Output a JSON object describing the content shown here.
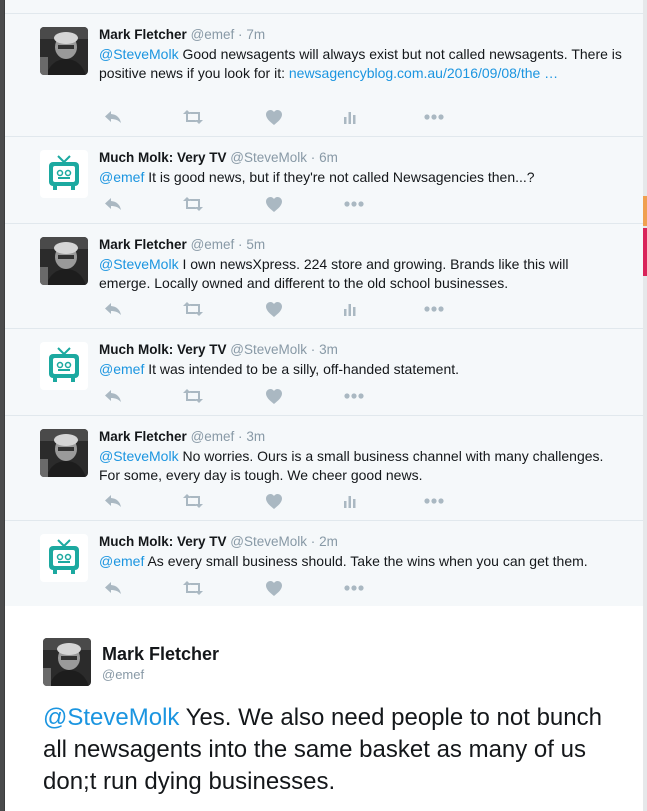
{
  "tweets": [
    {
      "author": "Mark Fletcher",
      "handle": "@emef",
      "sep": "·",
      "time": "7m",
      "mention": "@SteveMolk",
      "text": " Good newsagents will always exist but not called newsagents. There is positive news if you look for it: ",
      "link": "newsagencyblog.com.au/2016/09/08/the …",
      "avatar": "mark-fletcher-avatar",
      "analytics": true
    },
    {
      "author": "Much Molk: Very TV",
      "handle": "@SteveMolk",
      "sep": "·",
      "time": "6m",
      "mention": "@emef",
      "text": " It is good news, but if they're not called Newsagencies then...?",
      "link": "",
      "avatar": "much-molk-avatar",
      "analytics": false
    },
    {
      "author": "Mark Fletcher",
      "handle": "@emef",
      "sep": "·",
      "time": "5m",
      "mention": "@SteveMolk",
      "text": " I own newsXpress. 224 store and growing. Brands like this will emerge. Locally owned and different to the old school businesses.",
      "link": "",
      "avatar": "mark-fletcher-avatar",
      "analytics": true
    },
    {
      "author": "Much Molk: Very TV",
      "handle": "@SteveMolk",
      "sep": "·",
      "time": "3m",
      "mention": "@emef",
      "text": " It was intended to be a silly, off-handed statement.",
      "link": "",
      "avatar": "much-molk-avatar",
      "analytics": false
    },
    {
      "author": "Mark Fletcher",
      "handle": "@emef",
      "sep": "·",
      "time": "3m",
      "mention": "@SteveMolk",
      "text": " No worries. Ours is a small business channel with many challenges. For some, every day is tough. We cheer good news.",
      "link": "",
      "avatar": "mark-fletcher-avatar",
      "analytics": true
    },
    {
      "author": "Much Molk: Very TV",
      "handle": "@SteveMolk",
      "sep": "·",
      "time": "2m",
      "mention": "@emef",
      "text": " As every small business should. Take the wins when you can get them.",
      "link": "",
      "avatar": "much-molk-avatar",
      "analytics": false
    }
  ],
  "expanded": {
    "author": "Mark Fletcher",
    "handle": "@emef",
    "mention": "@SteveMolk",
    "text": " Yes. We also need people to not bunch all newsagents into the same basket as many of us don;t run dying businesses."
  },
  "icons": {
    "reply": "reply-icon",
    "retweet": "retweet-icon",
    "like": "heart-icon",
    "analytics": "analytics-icon",
    "more": "more-icon"
  },
  "colors": {
    "link": "#1b95e0",
    "icon": "#aab8c2",
    "muted": "#8899a6",
    "text": "#14171a",
    "teal": "#1ca9a0",
    "panel": "#f5f8fa"
  }
}
